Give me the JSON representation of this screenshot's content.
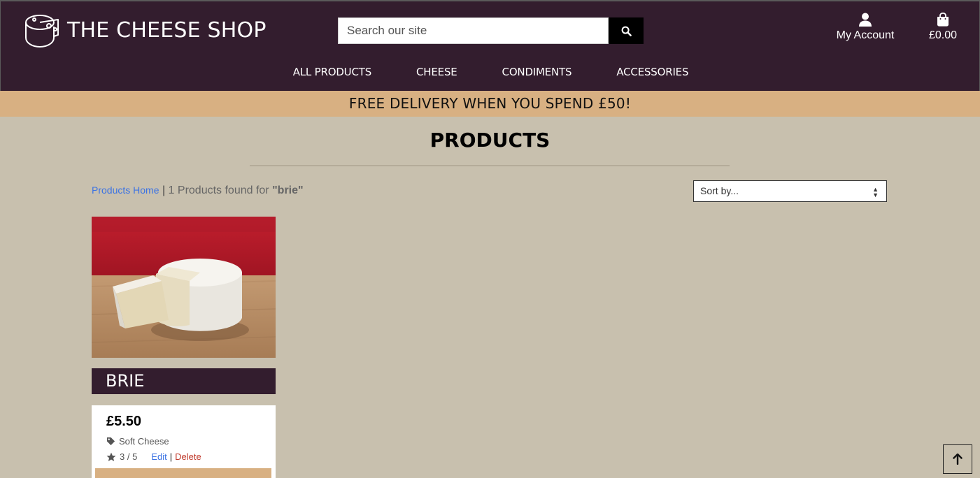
{
  "header": {
    "site_title": "THE CHEESE SHOP",
    "search": {
      "placeholder": "Search our site",
      "value": ""
    },
    "account_label": "My Account",
    "bag_total": "£0.00",
    "icons": {
      "logo": "cheese-wheel-icon",
      "search": "search-icon",
      "account": "user-icon",
      "bag": "shopping-bag-icon"
    }
  },
  "nav": {
    "items": [
      {
        "label": "ALL PRODUCTS"
      },
      {
        "label": "CHEESE"
      },
      {
        "label": "CONDIMENTS"
      },
      {
        "label": "ACCESSORIES"
      }
    ]
  },
  "banner": {
    "text": "FREE DELIVERY WHEN YOU SPEND £50!"
  },
  "main": {
    "title": "PRODUCTS",
    "breadcrumb": {
      "home_label": "Products Home",
      "separator": "|",
      "result_text": "1 Products found for",
      "search_term": "\"brie\""
    },
    "sort": {
      "selected": "Sort by..."
    }
  },
  "products": [
    {
      "name": "BRIE",
      "price": "£5.50",
      "category": "Soft Cheese",
      "rating": "3 / 5",
      "edit_label": "Edit",
      "action_separator": "|",
      "delete_label": "Delete"
    }
  ],
  "colors": {
    "header_bg": "#331d2e",
    "banner_bg": "#d8b082",
    "page_bg": "#c8c0ae",
    "link_blue": "#3b72e3",
    "delete_red": "#c0392b"
  },
  "back_to_top_icon": "arrow-up-icon"
}
